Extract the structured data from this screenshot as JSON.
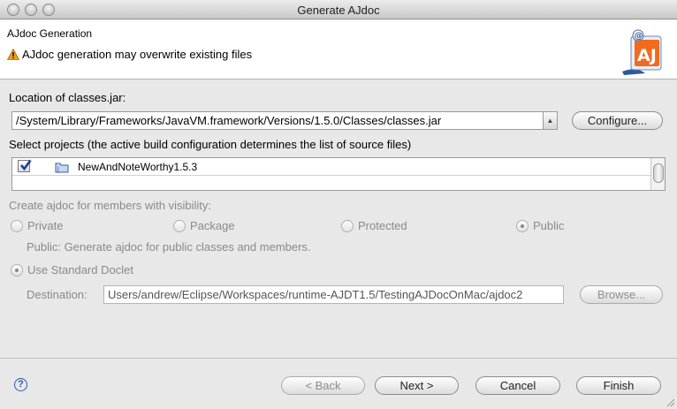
{
  "window": {
    "title": "Generate AJdoc"
  },
  "banner": {
    "title": "AJdoc Generation",
    "message": "AJdoc generation may overwrite existing files"
  },
  "classes_jar": {
    "label": "Location of classes.jar:",
    "value": "/System/Library/Frameworks/JavaVM.framework/Versions/1.5.0/Classes/classes.jar",
    "configure_label": "Configure..."
  },
  "projects": {
    "label": "Select projects (the active build configuration determines the list of source files)",
    "items": [
      {
        "name": "NewAndNoteWorthy1.5.3",
        "checked": true
      }
    ]
  },
  "visibility": {
    "label": "Create ajdoc for members with visibility:",
    "options": [
      "Private",
      "Package",
      "Protected",
      "Public"
    ],
    "selected": "Public",
    "description": "Public: Generate ajdoc for public classes and members."
  },
  "doclet": {
    "standard_label": "Use Standard Doclet",
    "destination_label": "Destination:",
    "destination_value": "Users/andrew/Eclipse/Workspaces/runtime-AJDT1.5/TestingAJDocOnMac/ajdoc2",
    "browse_label": "Browse..."
  },
  "footer": {
    "back_label": "< Back",
    "next_label": "Next >",
    "cancel_label": "Cancel",
    "finish_label": "Finish"
  },
  "colors": {
    "banner_bg": "#ffffff",
    "dialog_bg": "#e8e8e8",
    "help_blue": "#2b5aa8"
  }
}
